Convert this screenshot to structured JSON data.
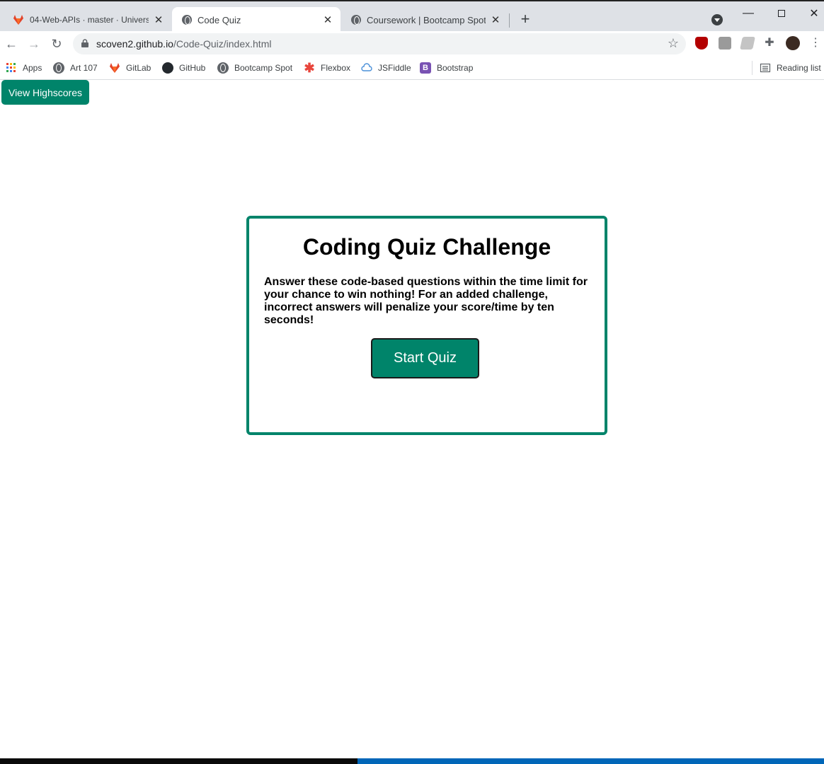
{
  "browser": {
    "tabs": [
      {
        "title": "04-Web-APIs · master · University",
        "icon": "gitlab-icon"
      },
      {
        "title": "Code Quiz",
        "icon": "globe-icon",
        "active": true
      },
      {
        "title": "Coursework | Bootcamp Spot",
        "icon": "globe-icon"
      }
    ],
    "url_host": "scoven2.github.io",
    "url_path": "/Code-Quiz/index.html",
    "bookmarks": [
      {
        "label": "Apps",
        "icon": "apps-grid-icon"
      },
      {
        "label": "Art 107",
        "icon": "globe-icon"
      },
      {
        "label": "GitLab",
        "icon": "gitlab-icon"
      },
      {
        "label": "GitHub",
        "icon": "github-icon"
      },
      {
        "label": "Bootcamp Spot",
        "icon": "globe-icon"
      },
      {
        "label": "Flexbox",
        "icon": "asterisk-icon"
      },
      {
        "label": "JSFiddle",
        "icon": "cloud-icon"
      },
      {
        "label": "Bootstrap",
        "icon": "bootstrap-icon"
      }
    ],
    "reading_list": "Reading list"
  },
  "page": {
    "highscores_label": "View Highscores",
    "title": "Coding Quiz Challenge",
    "description": "Answer these code-based questions within the time limit for your chance to win nothing! For an added challenge, incorrect answers will penalize your score/time by ten seconds!",
    "start_label": "Start Quiz"
  },
  "colors": {
    "accent": "#00846a",
    "tabstrip": "#dee1e6"
  }
}
